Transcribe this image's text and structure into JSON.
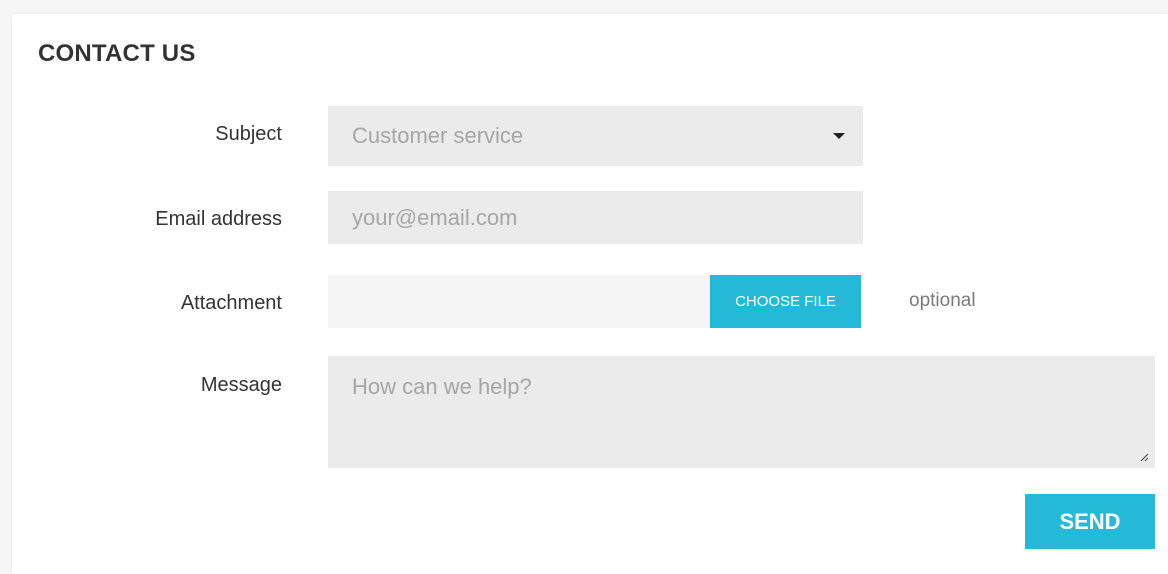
{
  "title": "CONTACT US",
  "labels": {
    "subject": "Subject",
    "email": "Email address",
    "attachment": "Attachment",
    "message": "Message"
  },
  "subject_select": {
    "selected": "Customer service"
  },
  "email_input": {
    "placeholder": "your@email.com"
  },
  "attachment": {
    "button_label": "CHOOSE FILE",
    "hint": "optional"
  },
  "message_input": {
    "placeholder": "How can we help?"
  },
  "send_button": "SEND",
  "icons": {
    "select_caret": "caret-down-icon",
    "resize": "resize-handle-icon"
  },
  "colors": {
    "accent": "#24b9d7",
    "field_background": "#ebebeb",
    "text": "#333333",
    "placeholder": "#a6a6a6"
  }
}
